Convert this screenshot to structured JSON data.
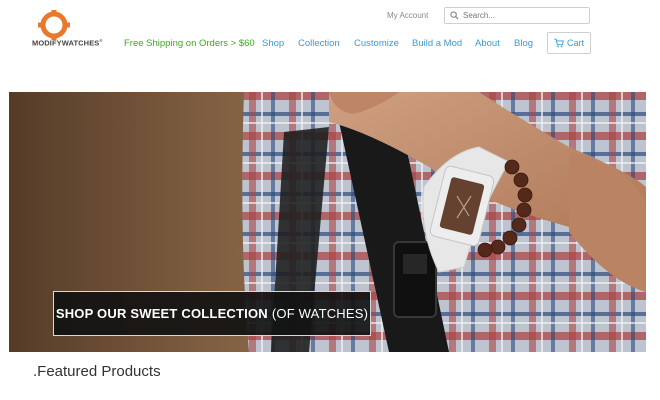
{
  "brand": {
    "logo_text": "MODIFYWATCHES",
    "logo_mark": "®",
    "accent": "#e8782c"
  },
  "header": {
    "my_account": "My Account",
    "search_placeholder": "Search...",
    "promo": "Free Shipping on Orders > $60",
    "nav": [
      {
        "label": "Shop"
      },
      {
        "label": "Collection"
      },
      {
        "label": "Customize"
      },
      {
        "label": "Build a Mod"
      },
      {
        "label": "About"
      },
      {
        "label": "Blog"
      }
    ],
    "cart_label": "Cart"
  },
  "hero": {
    "cta_bold": "SHOP OUR SWEET COLLECTION",
    "cta_rest": "(OF WATCHES)"
  },
  "featured_heading": ".Featured Products",
  "colors": {
    "promo_green": "#3cab17",
    "nav_blue": "#3a9bd5",
    "cta_bg": "#121212"
  }
}
